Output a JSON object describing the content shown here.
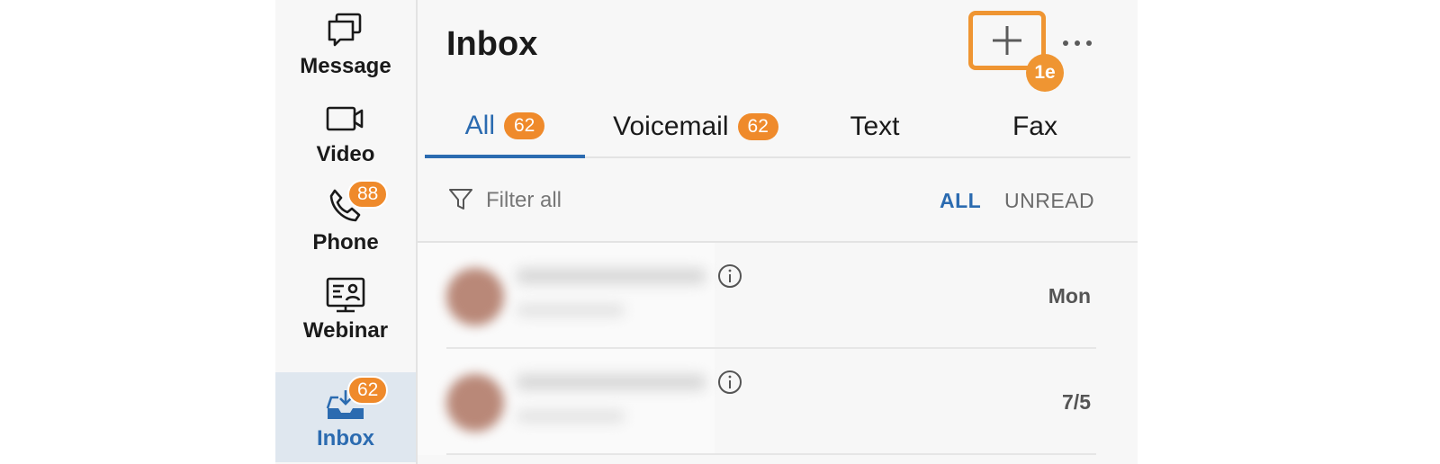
{
  "sidebar": {
    "items": [
      {
        "label": "Message",
        "icon": "message-icon",
        "badge": null,
        "active": false
      },
      {
        "label": "Video",
        "icon": "video-camera-icon",
        "badge": null,
        "active": false
      },
      {
        "label": "Phone",
        "icon": "phone-icon",
        "badge": "88",
        "active": false
      },
      {
        "label": "Webinar",
        "icon": "webinar-icon",
        "badge": null,
        "active": false
      },
      {
        "label": "Inbox",
        "icon": "inbox-icon",
        "badge": "62",
        "active": true
      }
    ]
  },
  "header": {
    "title": "Inbox",
    "add_icon": "plus-icon",
    "step_badge": "1e",
    "more_icon": "more-horizontal-icon"
  },
  "tabs": [
    {
      "label": "All",
      "badge": "62",
      "active": true
    },
    {
      "label": "Voicemail",
      "badge": "62",
      "active": false
    },
    {
      "label": "Text",
      "badge": null,
      "active": false
    },
    {
      "label": "Fax",
      "badge": null,
      "active": false
    }
  ],
  "filter": {
    "placeholder": "Filter all",
    "icon": "filter-funnel-icon",
    "segment_all": "ALL",
    "segment_unread": "UNREAD"
  },
  "list": {
    "rows": [
      {
        "date": "Mon",
        "info_icon": "info-icon"
      },
      {
        "date": "7/5",
        "info_icon": "info-icon"
      }
    ]
  },
  "colors": {
    "accent_blue": "#2b6bb0",
    "badge_orange": "#ef8a2b",
    "highlight_orange": "#ef9532"
  }
}
